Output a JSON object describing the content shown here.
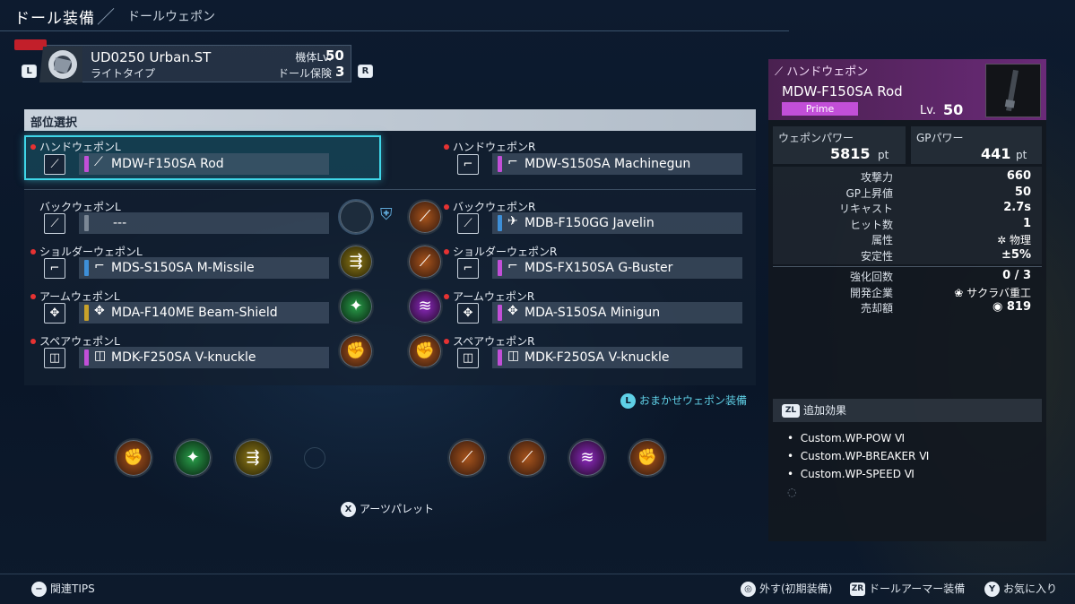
{
  "header": {
    "title": "ドール装備",
    "subtitle": "ドールウェポン"
  },
  "doll": {
    "name": "UD0250 Urban.ST",
    "type": "ライトタイプ",
    "level_label": "機体Lv.",
    "level": "50",
    "insurance_label": "ドール保険",
    "insurance": "3",
    "btn_l": "L",
    "btn_r": "R"
  },
  "part_select": "部位選択",
  "slots": {
    "hand_l": {
      "label": "ハンドウェポンL",
      "weapon": "MDW-F150SA Rod",
      "stripe": "#c24fd8",
      "icon": "rod-icon"
    },
    "hand_r": {
      "label": "ハンドウェポンR",
      "weapon": "MDW-S150SA Machinegun",
      "stripe": "#c24fd8",
      "icon": "machinegun-icon"
    },
    "back_l": {
      "label": "バックウェポンL",
      "weapon": "---",
      "stripe": "#7c8896",
      "icon": "back-weapon-icon"
    },
    "back_r": {
      "label": "バックウェポンR",
      "weapon": "MDB-F150GG Javelin",
      "stripe": "#3d8fd8",
      "icon": "javelin-icon"
    },
    "shoulder_l": {
      "label": "ショルダーウェポンL",
      "weapon": "MDS-S150SA M-Missile",
      "stripe": "#3d8fd8",
      "icon": "missile-icon"
    },
    "shoulder_r": {
      "label": "ショルダーウェポンR",
      "weapon": "MDS-FX150SA G-Buster",
      "stripe": "#c24fd8",
      "icon": "buster-icon"
    },
    "arm_l": {
      "label": "アームウェポンL",
      "weapon": "MDA-F140ME Beam-Shield",
      "stripe": "#c9a22a",
      "icon": "shield-icon"
    },
    "arm_r": {
      "label": "アームウェポンR",
      "weapon": "MDA-S150SA Minigun",
      "stripe": "#c24fd8",
      "icon": "minigun-icon"
    },
    "spare_l": {
      "label": "スペアウェポンL",
      "weapon": "MDK-F250SA V-knuckle",
      "stripe": "#c24fd8",
      "icon": "knuckle-icon"
    },
    "spare_r": {
      "label": "スペアウェポンR",
      "weapon": "MDK-F250SA V-knuckle",
      "stripe": "#c24fd8",
      "icon": "knuckle-icon"
    }
  },
  "auto_equip": "おまかせウェポン装備",
  "auto_btn": "L",
  "arts_palette": "アーツパレット",
  "arts_btn": "X",
  "detail": {
    "category": "ハンドウェポン",
    "name": "MDW-F150SA Rod",
    "rarity": "Prime",
    "level_label": "Lv.",
    "level": "50",
    "wp_label": "ウェポンパワー",
    "wp_value": "5815",
    "gp_label": "GPパワー",
    "gp_value": "441",
    "unit": "pt",
    "stats": [
      {
        "label": "攻撃力",
        "value": "660"
      },
      {
        "label": "GP上昇値",
        "value": "50"
      },
      {
        "label": "リキャスト",
        "value": "2.7s"
      },
      {
        "label": "ヒット数",
        "value": "1"
      },
      {
        "label": "属性",
        "value": "✲ 物理"
      },
      {
        "label": "安定性",
        "value": "±5%"
      }
    ],
    "stats2": [
      {
        "label": "強化回数",
        "value": "0 / 3"
      },
      {
        "label": "開発企業",
        "value": "サクラバ重工"
      },
      {
        "label": "売却額",
        "value": "819"
      }
    ],
    "effects_btn": "ZL",
    "effects_title": "追加効果",
    "effects": [
      "Custom.WP-POW Ⅵ",
      "Custom.WP-BREAKER Ⅵ",
      "Custom.WP-SPEED Ⅵ"
    ]
  },
  "footer": {
    "tips_btn": "−",
    "tips": "関連TIPS",
    "remove": "外す(初期装備)",
    "zr_btn": "ZR",
    "armor": "ドールアーマー装備",
    "y_btn": "Y",
    "fav": "お気に入り"
  },
  "colors": {
    "accent": "#3fd6e8",
    "prime": "#c24fd8",
    "required_dot": "#e63232"
  }
}
